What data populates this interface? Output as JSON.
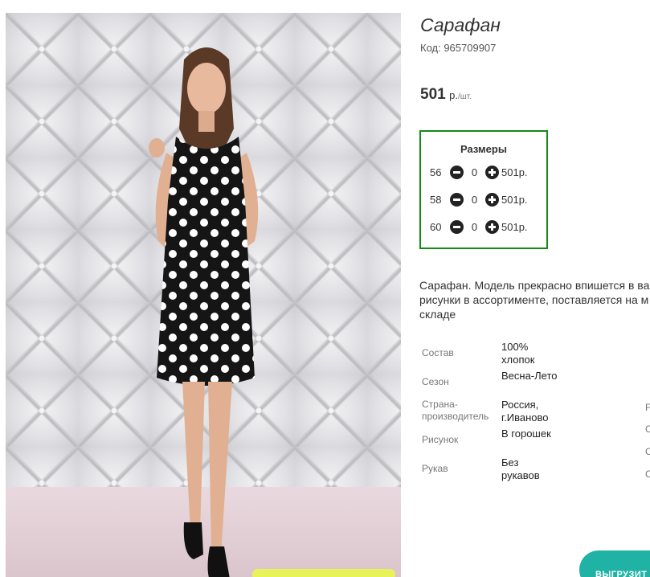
{
  "product": {
    "title": "Сарафан",
    "code": "Код: 965709907",
    "price_value": "501",
    "price_currency": "р.",
    "price_unit": "/шт."
  },
  "sizes": {
    "heading": "Размеры",
    "rows": [
      {
        "size": "56",
        "qty": "0",
        "price": "501р."
      },
      {
        "size": "58",
        "qty": "0",
        "price": "501р."
      },
      {
        "size": "60",
        "qty": "0",
        "price": "501р."
      }
    ],
    "minus_icon": "minus-circle-icon",
    "plus_icon": "plus-circle-icon"
  },
  "description": "Сарафан. Модель прекрасно впишется в ва рисунки в ассортименте, поставляется на м складе",
  "properties": [
    {
      "key": "Состав",
      "value": "100% хлопок"
    },
    {
      "key": "Сезон",
      "value": "Весна-Лето"
    },
    {
      "key": "Страна-производитель",
      "value": "Россия, г.Иваново"
    },
    {
      "key": "Рисунок",
      "value": "В горошек"
    },
    {
      "key": "Рукав",
      "value": "Без рукавов"
    }
  ],
  "edge_letters": [
    "F",
    "С",
    "С",
    "С"
  ],
  "export_button": "ВЫГРУЗИТ"
}
